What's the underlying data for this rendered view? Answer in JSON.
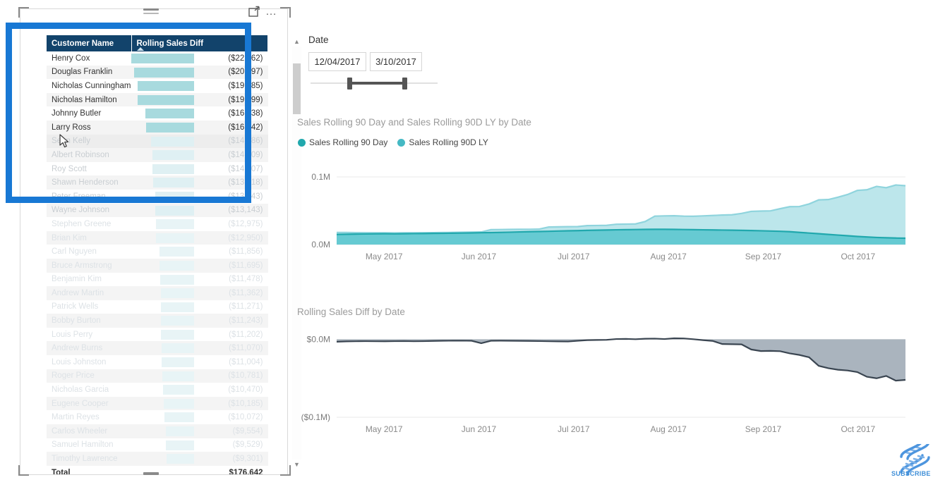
{
  "visual": {
    "focus_icon": "focus-mode-icon",
    "more_icon": "more-options-icon",
    "more_label": "…"
  },
  "table": {
    "columns": [
      "Customer Name",
      "Rolling Sales Diff"
    ],
    "sort_indicator": "sort-ascending-caret",
    "rows": [
      {
        "name": "Henry Cox",
        "value": "($22,162)",
        "bar": 100
      },
      {
        "name": "Douglas Franklin",
        "value": "($20,397)",
        "bar": 92
      },
      {
        "name": "Nicholas Cunningham",
        "value": "($19,185)",
        "bar": 86.6
      },
      {
        "name": "Nicholas Hamilton",
        "value": "($19,099)",
        "bar": 86.2
      },
      {
        "name": "Johnny Butler",
        "value": "($16,638)",
        "bar": 75.1
      },
      {
        "name": "Larry Ross",
        "value": "($16,442)",
        "bar": 74.2
      },
      {
        "name": "Sean Kelly",
        "value": "($14,586)",
        "bar": 65.8
      },
      {
        "name": "Albert Robinson",
        "value": "($14,109)",
        "bar": 63.7
      },
      {
        "name": "Roy Scott",
        "value": "($14,107)",
        "bar": 63.6
      },
      {
        "name": "Shawn Henderson",
        "value": "($13,818)",
        "bar": 62.3
      },
      {
        "name": "Peter Freeman",
        "value": "($13,143)",
        "bar": 59.3
      },
      {
        "name": "Wayne Johnson",
        "value": "($13,143)",
        "bar": 59.3
      },
      {
        "name": "Stephen Greene",
        "value": "($12,975)",
        "bar": 58.5
      },
      {
        "name": "Brian Kim",
        "value": "($12,950)",
        "bar": 58.4
      },
      {
        "name": "Carl Nguyen",
        "value": "($11,856)",
        "bar": 53.5
      },
      {
        "name": "Bruce Armstrong",
        "value": "($11,695)",
        "bar": 52.8
      },
      {
        "name": "Benjamin Kim",
        "value": "($11,478)",
        "bar": 51.8
      },
      {
        "name": "Andrew Martin",
        "value": "($11,362)",
        "bar": 51.3
      },
      {
        "name": "Patrick Wells",
        "value": "($11,271)",
        "bar": 50.9
      },
      {
        "name": "Bobby Burton",
        "value": "($11,243)",
        "bar": 50.7
      },
      {
        "name": "Louis Perry",
        "value": "($11,202)",
        "bar": 50.5
      },
      {
        "name": "Andrew Burns",
        "value": "($11,070)",
        "bar": 49.9
      },
      {
        "name": "Louis Johnston",
        "value": "($11,004)",
        "bar": 49.7
      },
      {
        "name": "Roger Price",
        "value": "($10,781)",
        "bar": 48.6
      },
      {
        "name": "Nicholas Garcia",
        "value": "($10,470)",
        "bar": 47.2
      },
      {
        "name": "Eugene Cooper",
        "value": "($10,185)",
        "bar": 46.0
      },
      {
        "name": "Martin Reyes",
        "value": "($10,072)",
        "bar": 45.4
      },
      {
        "name": "Carlos Wheeler",
        "value": "($9,554)",
        "bar": 43.1
      },
      {
        "name": "Samuel Hamilton",
        "value": "($9,529)",
        "bar": 43.0
      },
      {
        "name": "Timothy Lawrence",
        "value": "($9,301)",
        "bar": 42.0
      }
    ],
    "total_label": "Total",
    "total_value": "$176,642"
  },
  "slicer": {
    "label": "Date",
    "from": "12/04/2017",
    "to": "3/10/2017"
  },
  "chart_data": [
    {
      "type": "area",
      "title": "Sales Rolling 90 Day and Sales Rolling 90D LY by Date",
      "xlabel": "",
      "ylabel": "",
      "ylim": [
        0,
        0.1
      ],
      "ytick_labels": [
        "0.1M",
        "0.0M"
      ],
      "xtick_labels": [
        "May 2017",
        "Jun 2017",
        "Jul 2017",
        "Aug 2017",
        "Sep 2017",
        "Oct 2017"
      ],
      "legend": [
        "Sales Rolling 90 Day",
        "Sales Rolling 90D LY"
      ],
      "legend_position": "top-left",
      "grid": false,
      "colors": [
        "#21a8ad",
        "#8fd4dd"
      ],
      "x": [
        0,
        1,
        2,
        3,
        4,
        5,
        6,
        7,
        8,
        9,
        10,
        11,
        12,
        13,
        14,
        15,
        16,
        17,
        18,
        19,
        20,
        21,
        22,
        23,
        24,
        25,
        26,
        27,
        28,
        29,
        30,
        31,
        32,
        33,
        34,
        35,
        36,
        37,
        38,
        39,
        40,
        41,
        42,
        43,
        44,
        45,
        46,
        47,
        48,
        49,
        50,
        51,
        52,
        53,
        54,
        55,
        56,
        57,
        58,
        59
      ],
      "series": [
        {
          "name": "Sales Rolling 90 Day",
          "values": [
            0.015,
            0.0152,
            0.0155,
            0.0157,
            0.0159,
            0.016,
            0.0158,
            0.016,
            0.0162,
            0.0163,
            0.0165,
            0.0166,
            0.0168,
            0.017,
            0.0172,
            0.0175,
            0.0177,
            0.018,
            0.0183,
            0.0187,
            0.019,
            0.0193,
            0.0196,
            0.02,
            0.0203,
            0.0206,
            0.021,
            0.0212,
            0.0215,
            0.0218,
            0.022,
            0.0222,
            0.0224,
            0.0225,
            0.0225,
            0.0224,
            0.0222,
            0.022,
            0.0218,
            0.0216,
            0.0214,
            0.0212,
            0.021,
            0.0207,
            0.0204,
            0.02,
            0.0196,
            0.019,
            0.018,
            0.017,
            0.016,
            0.015,
            0.014,
            0.013,
            0.012,
            0.0112,
            0.0105,
            0.01,
            0.0096,
            0.0094
          ]
        },
        {
          "name": "Sales Rolling 90D LY",
          "values": [
            0.0178,
            0.0178,
            0.0176,
            0.0175,
            0.0174,
            0.0173,
            0.0172,
            0.0173,
            0.0174,
            0.0175,
            0.0176,
            0.0178,
            0.018,
            0.0182,
            0.0184,
            0.0186,
            0.022,
            0.0222,
            0.0224,
            0.0225,
            0.0226,
            0.0228,
            0.026,
            0.0262,
            0.0264,
            0.0266,
            0.028,
            0.0282,
            0.0284,
            0.03,
            0.0302,
            0.0305,
            0.034,
            0.042,
            0.0424,
            0.0426,
            0.042,
            0.0418,
            0.0424,
            0.043,
            0.0436,
            0.044,
            0.046,
            0.049,
            0.0495,
            0.0498,
            0.053,
            0.056,
            0.0562,
            0.06,
            0.066,
            0.0665,
            0.07,
            0.074,
            0.08,
            0.081,
            0.086,
            0.084,
            0.088,
            0.087
          ]
        }
      ]
    },
    {
      "type": "area",
      "title": "Rolling Sales Diff by Date",
      "xlabel": "",
      "ylabel": "",
      "ylim": [
        -0.1,
        0.005
      ],
      "ytick_labels": [
        "$0.0M",
        "($0.1M)"
      ],
      "xtick_labels": [
        "May 2017",
        "Jun 2017",
        "Jul 2017",
        "Aug 2017",
        "Sep 2017",
        "Oct 2017"
      ],
      "grid": false,
      "colors": [
        "#3a4551",
        "#9ba7b3"
      ],
      "x": [
        0,
        1,
        2,
        3,
        4,
        5,
        6,
        7,
        8,
        9,
        10,
        11,
        12,
        13,
        14,
        15,
        16,
        17,
        18,
        19,
        20,
        21,
        22,
        23,
        24,
        25,
        26,
        27,
        28,
        29,
        30,
        31,
        32,
        33,
        34,
        35,
        36,
        37,
        38,
        39,
        40,
        41,
        42,
        43,
        44,
        45,
        46,
        47,
        48,
        49,
        50,
        51,
        52,
        53,
        54,
        55,
        56,
        57,
        58,
        59
      ],
      "series": [
        {
          "name": "Rolling Sales Diff",
          "values": [
            -0.003,
            -0.0026,
            -0.0024,
            -0.0023,
            -0.0024,
            -0.0025,
            -0.0023,
            -0.0022,
            -0.0024,
            -0.0023,
            -0.002,
            -0.0018,
            -0.0017,
            -0.0016,
            -0.0018,
            -0.005,
            -0.0018,
            -0.0017,
            -0.0018,
            -0.0019,
            -0.002,
            -0.0022,
            -0.0024,
            -0.0026,
            -0.0027,
            -0.0018,
            -0.001,
            -0.0008,
            -0.0006,
            0.0004,
            0.0006,
            0.0002,
            0.0008,
            0.001,
            0.0004,
            0.0014,
            0.0012,
            0.0002,
            -0.001,
            -0.002,
            -0.006,
            -0.0062,
            -0.0064,
            -0.013,
            -0.015,
            -0.0148,
            -0.0152,
            -0.018,
            -0.02,
            -0.023,
            -0.034,
            -0.037,
            -0.039,
            -0.04,
            -0.042,
            -0.048,
            -0.05,
            -0.047,
            -0.053,
            -0.052
          ]
        }
      ]
    }
  ],
  "watermark": {
    "label": "SUBSCRIBE",
    "icon": "dna-helix-icon"
  }
}
